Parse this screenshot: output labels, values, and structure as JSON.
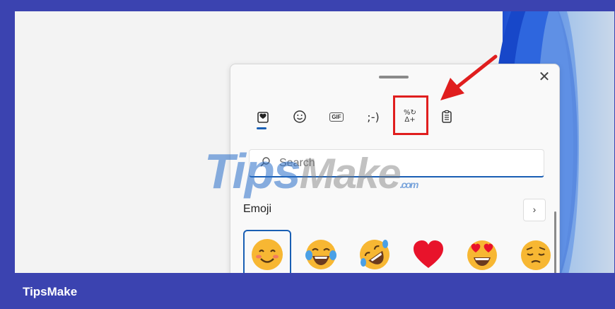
{
  "brand": "TipsMake",
  "watermark": {
    "tips": "Tips",
    "make": "Make",
    "com": ".com"
  },
  "panel": {
    "close_glyph": "✕",
    "tabs": [
      {
        "name": "favorites",
        "icon": "clipboard-heart-icon"
      },
      {
        "name": "emoji",
        "icon": "smiley-icon"
      },
      {
        "name": "gif",
        "label": "GIF"
      },
      {
        "name": "kaomoji",
        "label": ";-)"
      },
      {
        "name": "symbols",
        "label_top": "%↻",
        "label_bottom": "Δ+"
      },
      {
        "name": "clipboard-history",
        "icon": "clipboard-icon"
      }
    ],
    "search": {
      "placeholder": "Search"
    },
    "section": {
      "label": "Emoji",
      "more": "›"
    },
    "emojis": [
      "smiling-face-with-smiling-eyes",
      "face-with-tears-of-joy",
      "rolling-on-the-floor-laughing",
      "red-heart",
      "smiling-face-with-heart-eyes",
      "pensive-face"
    ]
  },
  "colors": {
    "accent": "#1a5fb4",
    "highlight": "#e01e1e",
    "frame": "#3b43b0"
  }
}
